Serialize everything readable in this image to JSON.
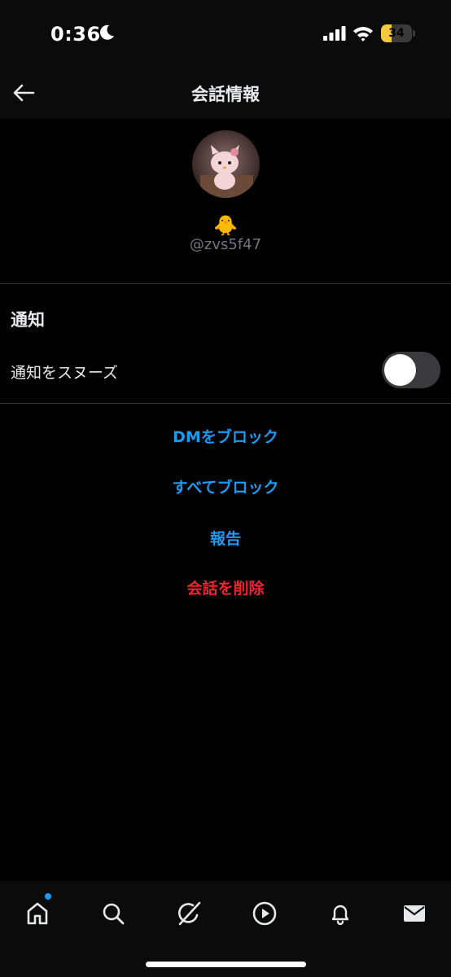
{
  "status_bar": {
    "time": "0:36",
    "battery": "34",
    "battery_level": 0.34
  },
  "header": {
    "title": "会話情報"
  },
  "profile": {
    "display_name": "🐥",
    "username": "@zvs5f47"
  },
  "notifications": {
    "section_title": "通知",
    "snooze_label": "通知をスヌーズ",
    "snooze_enabled": false
  },
  "actions": {
    "block_dm": "DMをブロック",
    "block_all": "すべてブロック",
    "report": "報告",
    "delete": "会話を削除"
  },
  "bottom_nav": {
    "items": [
      "home-icon",
      "search-icon",
      "grok-icon",
      "video-icon",
      "bell-icon",
      "mail-icon"
    ]
  },
  "colors": {
    "accent": "#1d9bf0",
    "danger": "#f4212e",
    "background": "#000000"
  }
}
